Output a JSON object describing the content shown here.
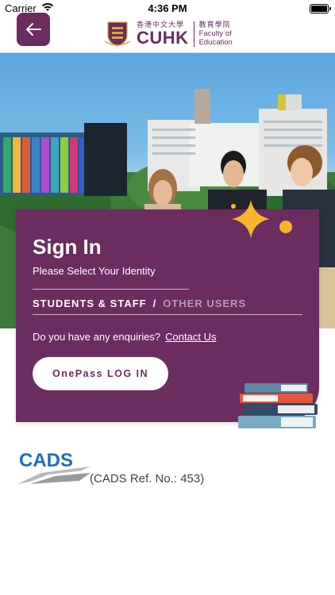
{
  "status_bar": {
    "carrier": "Carrier",
    "time": "4:36 PM"
  },
  "header": {
    "back_icon": "arrow-left-icon",
    "logo": {
      "chinese_university": "香港中文大學",
      "abbreviation": "CUHK",
      "chinese_faculty": "教育學院",
      "faculty_line1": "Faculty of",
      "faculty_line2": "Education"
    }
  },
  "card": {
    "title": "Sign In",
    "subtitle": "Please Select Your Identity",
    "tabs": [
      {
        "label": "STUDENTS & STAFF",
        "active": true
      },
      {
        "label": "OTHER USERS",
        "active": false
      }
    ],
    "tab_separator": "/",
    "enquiry_text": "Do you have any enquiries?",
    "contact_label": "Contact Us",
    "onepass_label": "OnePass LOG IN"
  },
  "footer": {
    "cads_logo_text": "CADS",
    "cads_ref": "(CADS Ref. No.: 453)"
  },
  "colors": {
    "brand": "#6b2c60",
    "accent_star": "#f7b42c"
  }
}
